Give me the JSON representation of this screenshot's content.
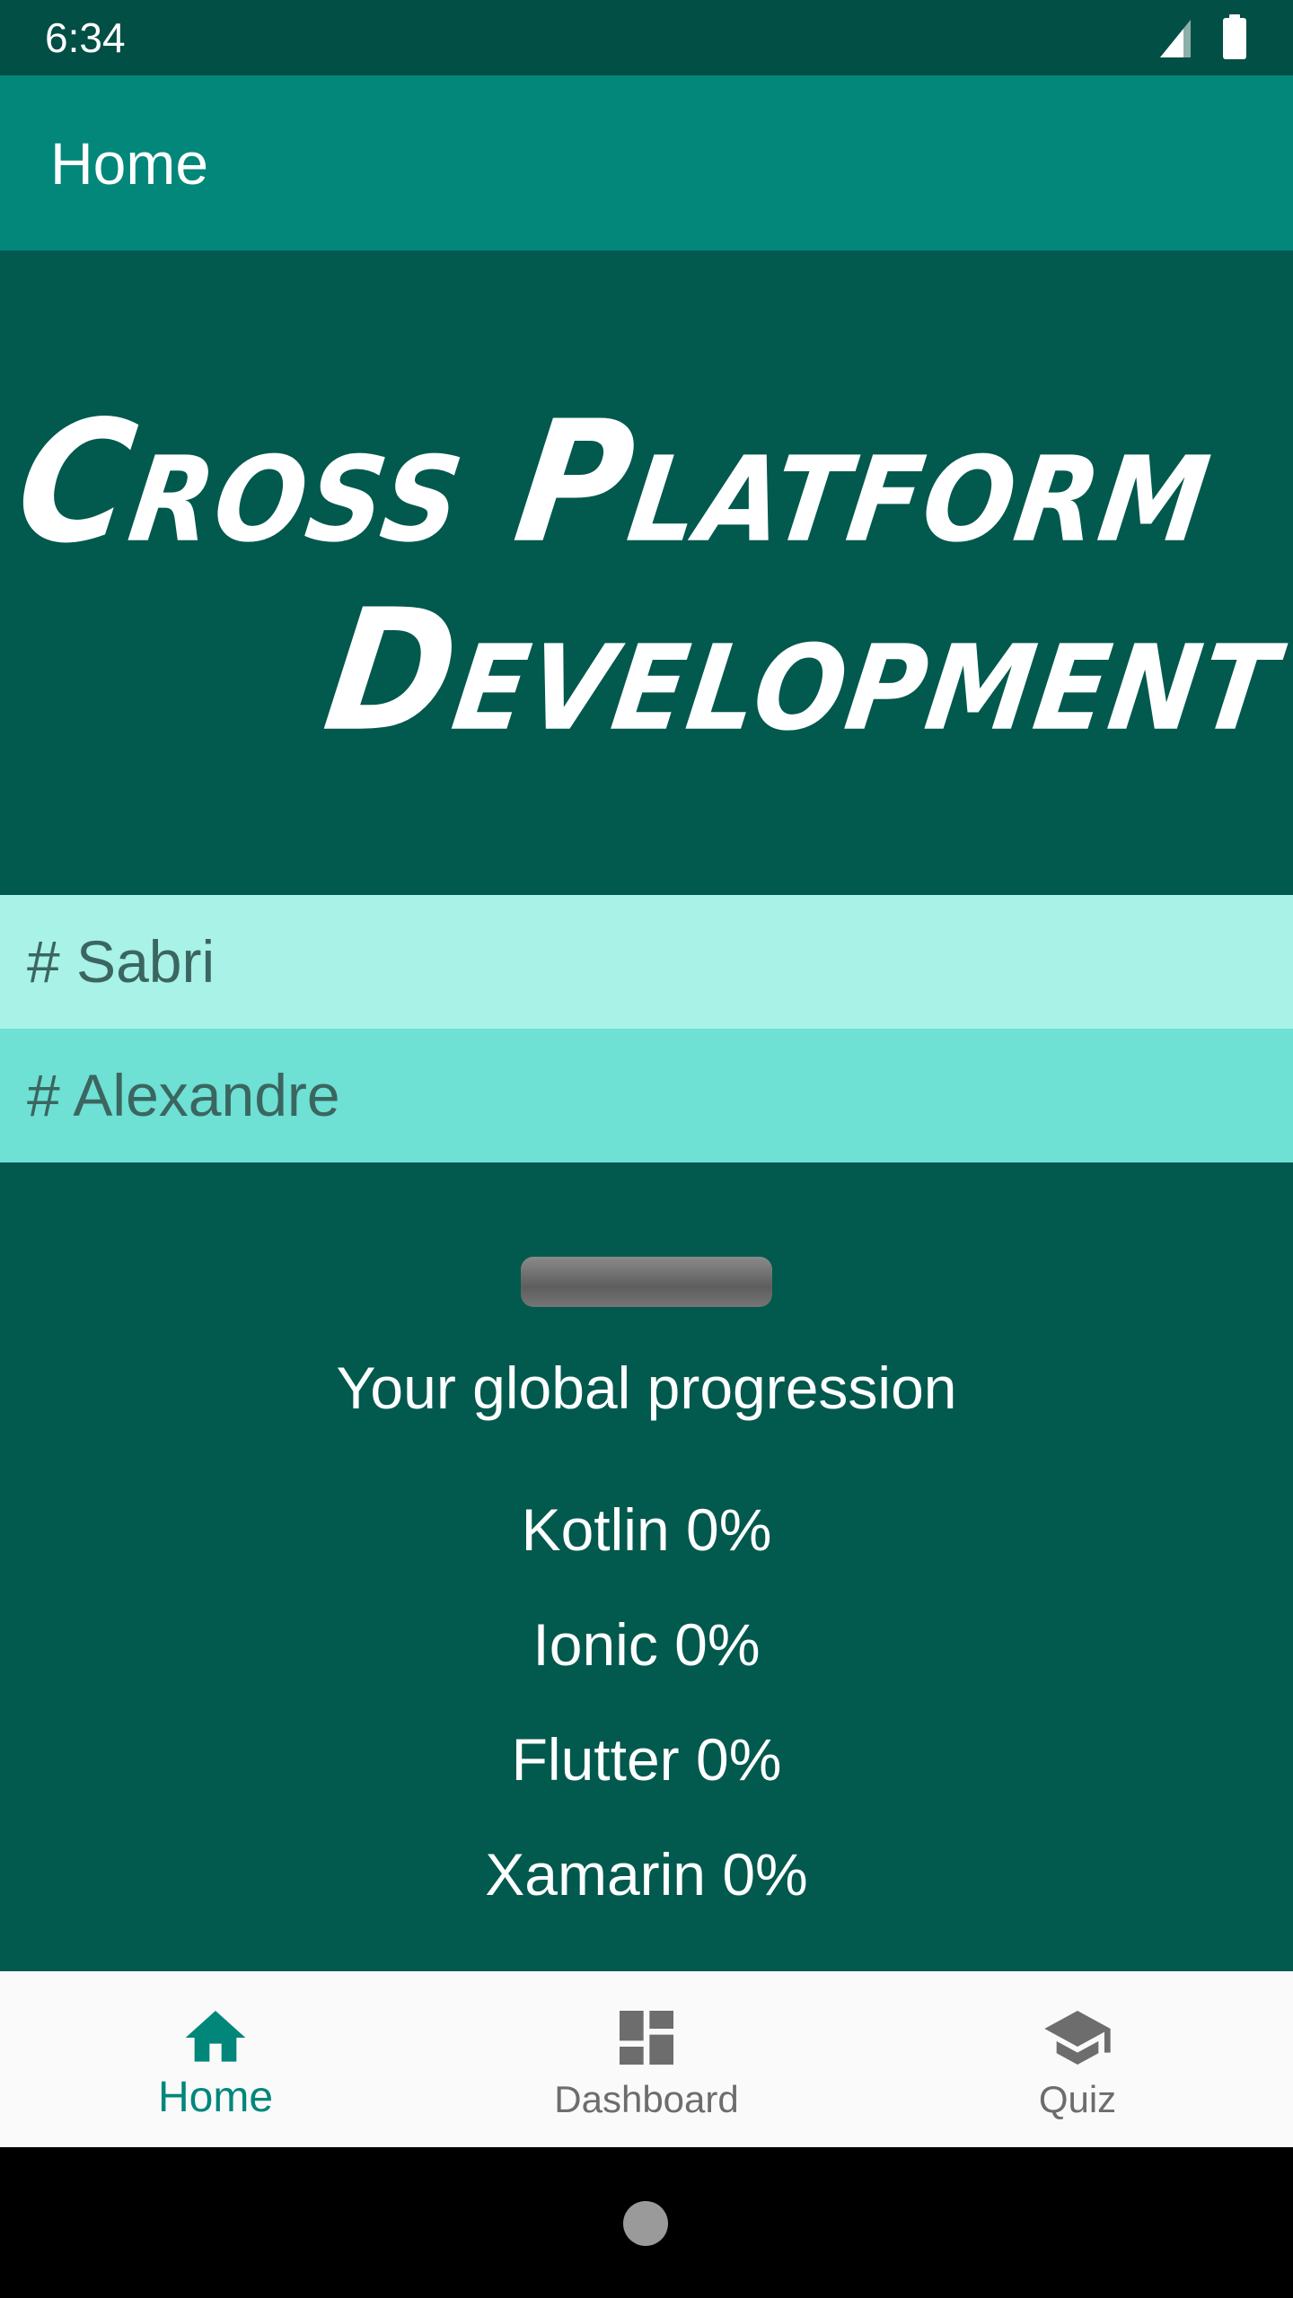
{
  "status_bar": {
    "time": "6:34",
    "icons": [
      "signal-icon",
      "battery-icon"
    ]
  },
  "app_bar": {
    "title": "Home"
  },
  "banner": {
    "line1": "Cross Platform",
    "line2": "Development"
  },
  "authors": [
    {
      "label": "# Sabri"
    },
    {
      "label": "# Alexandre"
    }
  ],
  "progress": {
    "title": "Your global progression",
    "value": 0,
    "languages": [
      {
        "label": "Kotlin 0%"
      },
      {
        "label": "Ionic 0%"
      },
      {
        "label": "Flutter 0%"
      },
      {
        "label": "Xamarin 0%"
      }
    ]
  },
  "bottom_nav": {
    "items": [
      {
        "label": "Home",
        "icon": "home-icon",
        "active": true
      },
      {
        "label": "Dashboard",
        "icon": "dashboard-icon",
        "active": false
      },
      {
        "label": "Quiz",
        "icon": "school-icon",
        "active": false
      }
    ]
  },
  "colors": {
    "status_bar": "#024f45",
    "app_bar": "#02877a",
    "background": "#02594e",
    "author_row_1": "#a8f2e8",
    "author_row_2": "#6ee0d4",
    "nav_active": "#00877a",
    "nav_inactive": "#6d6d6d"
  }
}
